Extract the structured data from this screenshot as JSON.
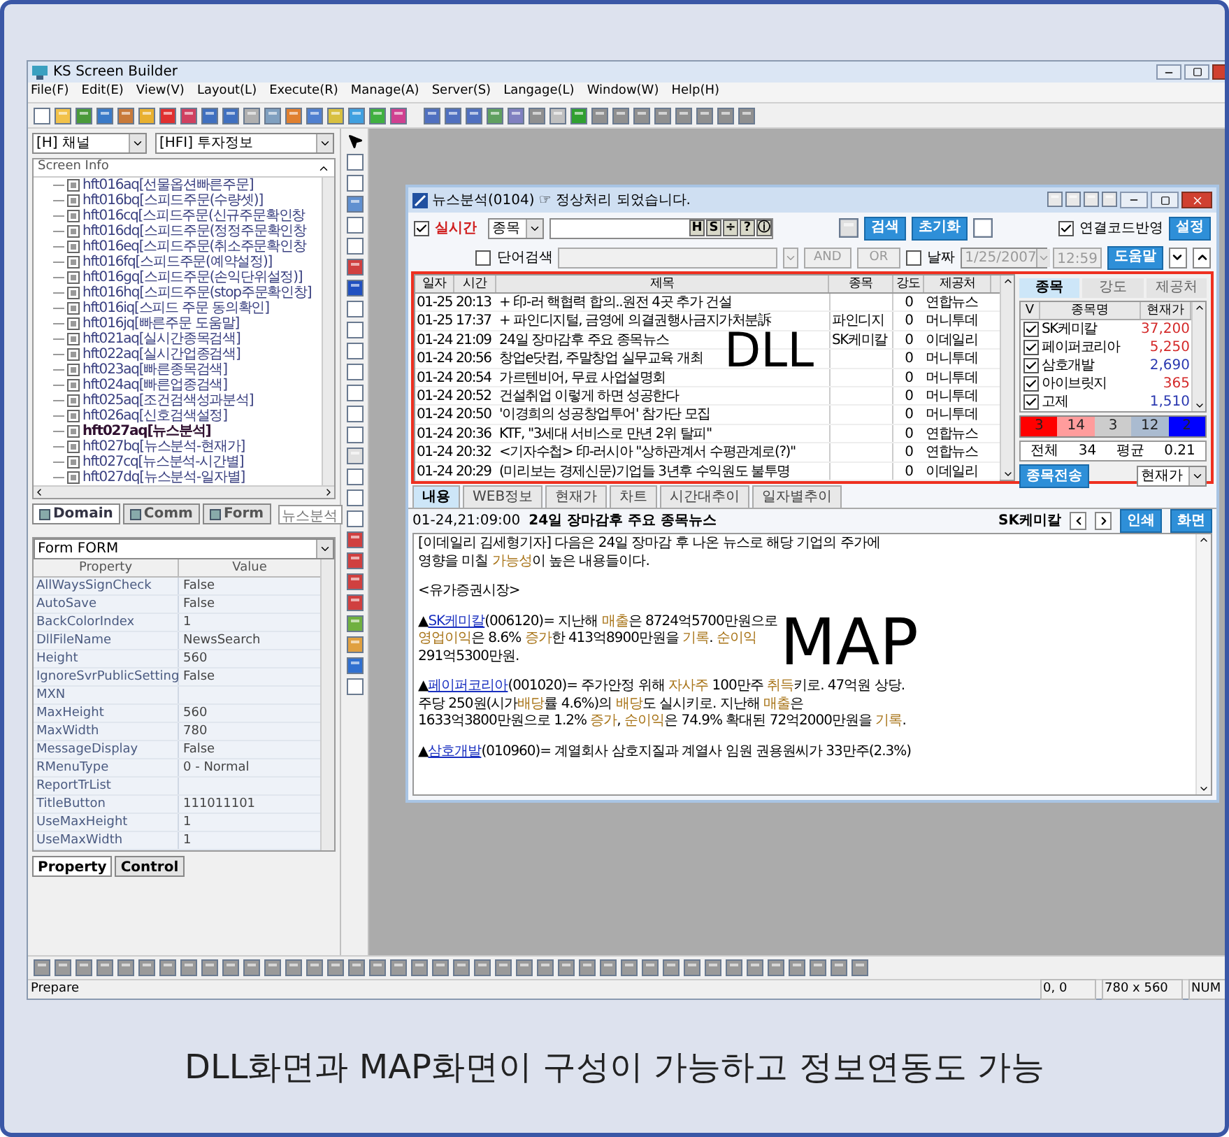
{
  "app": {
    "title": "KS Screen Builder",
    "menu": [
      "File(F)",
      "Edit(E)",
      "View(V)",
      "Layout(L)",
      "Execute(R)",
      "Manage(A)",
      "Server(S)",
      "Langage(L)",
      "Window(W)",
      "Help(H)"
    ],
    "status_bar": {
      "message": "Prepare",
      "position": "0, 0",
      "size": "780 x 560",
      "mode": "NUM"
    }
  },
  "left_panel": {
    "channel_combo": "[H] 채널",
    "group_combo": "[HFI] 투자정보",
    "tree": {
      "header": "Screen Info",
      "items": [
        {
          "label": "hft016aq[선물옵션빠른주문]",
          "selected": false
        },
        {
          "label": "hft016bq[스피드주문(수량셋)]",
          "selected": false
        },
        {
          "label": "hft016cq[스피드주문(신규주문확인창",
          "selected": false
        },
        {
          "label": "hft016dq[스피드주문(정정주문확인창",
          "selected": false
        },
        {
          "label": "hft016eq[스피드주문(취소주문확인창",
          "selected": false
        },
        {
          "label": "hft016fq[스피드주문(예약설정)]",
          "selected": false
        },
        {
          "label": "hft016gq[스피드주문(손익단위설정)]",
          "selected": false
        },
        {
          "label": "hft016hq[스피드주문(stop주문확인창]",
          "selected": false
        },
        {
          "label": "hft016iq[스피드 주문 동의확인]",
          "selected": false
        },
        {
          "label": "hft016jq[빠른주문 도움말]",
          "selected": false
        },
        {
          "label": "hft021aq[실시간종목검색]",
          "selected": false
        },
        {
          "label": "hft022aq[실시간업종검색]",
          "selected": false
        },
        {
          "label": "hft023aq[빠른종목검색]",
          "selected": false
        },
        {
          "label": "hft024aq[빠른업종검색]",
          "selected": false
        },
        {
          "label": "hft025aq[조건검색성과분석]",
          "selected": false
        },
        {
          "label": "hft026aq[신호검색설정]",
          "selected": false
        },
        {
          "label": "hft027aq[뉴스분석]",
          "selected": true
        },
        {
          "label": "hft027bq[뉴스분석-현재가]",
          "selected": false
        },
        {
          "label": "hft027cq[뉴스분석-시간별]",
          "selected": false
        },
        {
          "label": "hft027dq[뉴스분석-일자별]",
          "selected": false
        }
      ]
    },
    "domain_tabs": [
      {
        "label": "Domain",
        "selected": true
      },
      {
        "label": "Comm",
        "selected": false
      },
      {
        "label": "Form",
        "selected": false
      }
    ],
    "search_value": "뉴스분석",
    "properties": {
      "object_combo": "Form FORM",
      "columns": [
        "Property",
        "Value"
      ],
      "rows": [
        {
          "name": "AllWaysSignCheck",
          "value": "False"
        },
        {
          "name": "AutoSave",
          "value": "False"
        },
        {
          "name": "BackColorIndex",
          "value": "1"
        },
        {
          "name": "DllFileName",
          "value": "NewsSearch"
        },
        {
          "name": "Height",
          "value": "560"
        },
        {
          "name": "IgnoreSvrPublicSetting",
          "value": "False"
        },
        {
          "name": "MXN"
        },
        {
          "name": "MaxHeight",
          "value": "560"
        },
        {
          "name": "MaxWidth",
          "value": "780"
        },
        {
          "name": "MessageDisplay",
          "value": "False"
        },
        {
          "name": "RMenuType",
          "value": "0 - Normal"
        },
        {
          "name": "ReportTrList"
        },
        {
          "name": "TitleButton",
          "value": "111011101"
        },
        {
          "name": "UseMaxHeight",
          "value": "1"
        },
        {
          "name": "UseMaxWidth",
          "value": "1"
        }
      ]
    },
    "bottom_tabs": [
      {
        "label": "Property",
        "selected": true
      },
      {
        "label": "Control",
        "selected": false
      }
    ]
  },
  "news_window": {
    "title": "뉴스분석(0104) ☞ 정상처리 되었습니다.",
    "realtime": {
      "label": "실시간",
      "checked": true
    },
    "type_combo": "종목",
    "code_buttons": [
      "H",
      "S",
      "÷",
      "?",
      "ⓘ"
    ],
    "search_button": "검색",
    "reset_button": "초기화",
    "link_code": {
      "label": "연결코드반영",
      "checked": true
    },
    "settings_button": "설정",
    "word_search": {
      "label": "단어검색",
      "checked": false
    },
    "and_button": "AND",
    "or_button": "OR",
    "date": {
      "label": "날짜",
      "checked": false
    },
    "date_value": "1/25/2007",
    "time_value": "12:59",
    "help_button": "도움말",
    "list": {
      "columns": [
        "일자",
        "시간",
        "제목",
        "종목",
        "강도",
        "제공처"
      ],
      "rows": [
        [
          "01-25",
          "20:13",
          "+ 印-러 핵협력 합의..원전 4곳 추가 건설",
          "",
          "0",
          "연합뉴스"
        ],
        [
          "01-25",
          "17:37",
          "+ 파인디지털, 금영에 의결권행사금지가처분訴",
          "파인디지",
          "0",
          "머니투데"
        ],
        [
          "01-24",
          "21:09",
          "24일 장마감후 주요 종목뉴스",
          "SK케미칼",
          "0",
          "이데일리"
        ],
        [
          "01-24",
          "20:56",
          "창업e닷컴, 주말창업 실무교육 개최",
          "",
          "0",
          "머니투데"
        ],
        [
          "01-24",
          "20:54",
          "가르텐비어, 무료 사업설명회",
          "",
          "0",
          "머니투데"
        ],
        [
          "01-24",
          "20:52",
          "건설취업 이렇게 하면 성공한다",
          "",
          "0",
          "머니투데"
        ],
        [
          "01-24",
          "20:50",
          "'이경희의 성공창업투어' 참가단 모집",
          "",
          "0",
          "머니투데"
        ],
        [
          "01-24",
          "20:36",
          "KTF, \"3세대 서비스로 만년 2위 탈피\"",
          "",
          "0",
          "연합뉴스"
        ],
        [
          "01-24",
          "20:32",
          "<기자수첩> 印-러시아 \"상하관계서 수평관계로(?)\"",
          "",
          "0",
          "연합뉴스"
        ],
        [
          "01-24",
          "20:29",
          "(미리보는 경제신문)기업들 3년후 수익원도 불투명",
          "",
          "0",
          "이데일리"
        ]
      ]
    },
    "side": {
      "tabs": [
        {
          "label": "종목",
          "selected": true
        },
        {
          "label": "강도",
          "selected": false
        },
        {
          "label": "제공처",
          "selected": false
        }
      ],
      "columns": [
        "V",
        "종목명",
        "현재가"
      ],
      "rows": [
        {
          "name": "SK케미칼",
          "price": "37,200",
          "checked": true,
          "color": "#d42a2a"
        },
        {
          "name": "페이퍼코리아",
          "price": "5,250",
          "checked": true,
          "color": "#d42a2a"
        },
        {
          "name": "삼호개발",
          "price": "2,690",
          "checked": true,
          "color": "#2a38b0"
        },
        {
          "name": "아이브릿지",
          "price": "365",
          "checked": true,
          "color": "#d42a2a"
        },
        {
          "name": "고제",
          "price": "1,510",
          "checked": true,
          "color": "#2a38b0"
        }
      ],
      "counts": [
        {
          "value": "3",
          "color": "#ff0000"
        },
        {
          "value": "14",
          "color": "#ff9c9c"
        },
        {
          "value": "3",
          "color": "#cccccc"
        },
        {
          "value": "12",
          "color": "#aabbd0"
        },
        {
          "value": "2",
          "color": "#0000ff"
        }
      ],
      "total_label": "전체",
      "total": "34",
      "avg_label": "평균",
      "avg": "0.21",
      "send_button": "종목전송",
      "price_combo": "현재가"
    },
    "detail_tabs": [
      {
        "label": "내용",
        "selected": true
      },
      {
        "label": "WEB정보",
        "selected": false
      },
      {
        "label": "현재가",
        "selected": false
      },
      {
        "label": "차트",
        "selected": false
      },
      {
        "label": "시간대추이",
        "selected": false
      },
      {
        "label": "일자별추이",
        "selected": false
      }
    ],
    "detail_header": {
      "datetime": "01-24,21:09:00",
      "headline": "24일 장마감후 주요 종목뉴스",
      "stock": "SK케미칼",
      "print_button": "인쇄",
      "screen_button": "화면"
    },
    "article": {
      "paragraphs": [
        {
          "lines": [
            [
              {
                "kind": "text",
                "text": "[이데일리 김세형기자] 다음은 24일 장마감 후 나온 뉴스로 해당 기업의 주가에"
              }
            ],
            [
              {
                "kind": "text",
                "text": "영향을 미칠 "
              },
              {
                "kind": "term",
                "text": "가능성"
              },
              {
                "kind": "text",
                "text": "이 높은 내용들이다."
              }
            ]
          ]
        },
        {
          "lines": [
            [
              {
                "kind": "text",
                "text": "<유가증권시장>"
              }
            ]
          ]
        },
        {
          "lines": [
            [
              {
                "kind": "text",
                "text": "▲"
              },
              {
                "kind": "link",
                "text": "SK케미칼"
              },
              {
                "kind": "text",
                "text": "(006120)= 지난해 "
              },
              {
                "kind": "term",
                "text": "매출"
              },
              {
                "kind": "text",
                "text": "은 8724억5700만원으로"
              }
            ],
            [
              {
                "kind": "term",
                "text": "영업이익"
              },
              {
                "kind": "text",
                "text": "은 8.6% "
              },
              {
                "kind": "term",
                "text": "증가"
              },
              {
                "kind": "text",
                "text": "한 413억8900만원을 "
              },
              {
                "kind": "term",
                "text": "기록"
              },
              {
                "kind": "text",
                "text": ". "
              },
              {
                "kind": "term",
                "text": "순이익"
              }
            ],
            [
              {
                "kind": "text",
                "text": "291억5300만원."
              }
            ]
          ]
        },
        {
          "lines": [
            [
              {
                "kind": "text",
                "text": "▲"
              },
              {
                "kind": "link",
                "text": "페이퍼코리아"
              },
              {
                "kind": "text",
                "text": "(001020)= 주가안정 위해 "
              },
              {
                "kind": "term",
                "text": "자사주"
              },
              {
                "kind": "text",
                "text": " 100만주 "
              },
              {
                "kind": "term",
                "text": "취득"
              },
              {
                "kind": "text",
                "text": "키로. 47억원 상당."
              }
            ],
            [
              {
                "kind": "text",
                "text": "주당 250원(시가"
              },
              {
                "kind": "term",
                "text": "배당"
              },
              {
                "kind": "text",
                "text": "률 4.6%)의 "
              },
              {
                "kind": "term",
                "text": "배당"
              },
              {
                "kind": "text",
                "text": "도 실시키로. 지난해 "
              },
              {
                "kind": "term",
                "text": "매출"
              },
              {
                "kind": "text",
                "text": "은"
              }
            ],
            [
              {
                "kind": "text",
                "text": "1633억3800만원으로 1.2% "
              },
              {
                "kind": "term",
                "text": "증가"
              },
              {
                "kind": "text",
                "text": ", "
              },
              {
                "kind": "term",
                "text": "순이익"
              },
              {
                "kind": "text",
                "text": "은 74.9% 확대된 72억2000만원을 "
              },
              {
                "kind": "term",
                "text": "기록"
              },
              {
                "kind": "text",
                "text": "."
              }
            ]
          ]
        },
        {
          "lines": [
            [
              {
                "kind": "text",
                "text": "▲"
              },
              {
                "kind": "link",
                "text": "삼호개발"
              },
              {
                "kind": "text",
                "text": "(010960)= 계열회사 삼호지질과 계열사 임원 권용원씨가 33만주(2.3%)"
              }
            ]
          ]
        }
      ]
    }
  },
  "overlays": {
    "dll": "DLL",
    "map": "MAP"
  },
  "slide": {
    "caption": "DLL화면과 MAP화면이 구성이 가능하고 정보연동도 가능"
  }
}
